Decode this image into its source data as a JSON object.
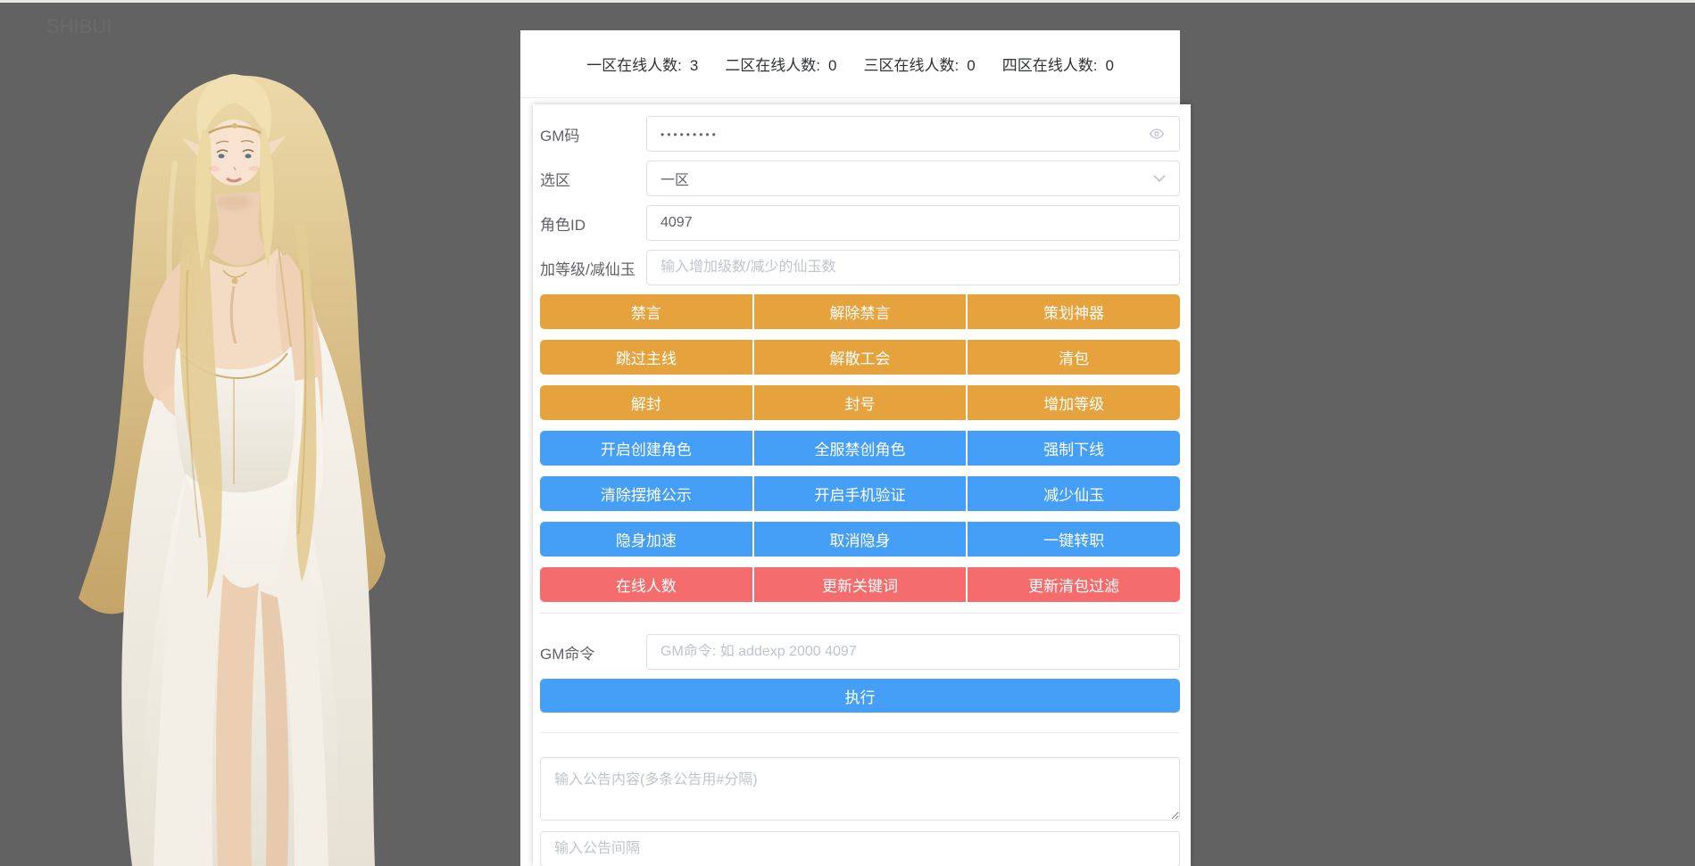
{
  "header": {
    "counts": [
      {
        "label": "一区在线人数:",
        "value": "3"
      },
      {
        "label": "二区在线人数:",
        "value": "0"
      },
      {
        "label": "三区在线人数:",
        "value": "0"
      },
      {
        "label": "四区在线人数:",
        "value": "0"
      }
    ]
  },
  "form": {
    "fields": [
      {
        "label": "GM码",
        "type": "password",
        "display_value": "•••••••••"
      },
      {
        "label": "选区",
        "type": "select",
        "value": "一区"
      },
      {
        "label": "角色ID",
        "type": "text",
        "value": "4097"
      },
      {
        "label": "加等级/减仙玉",
        "type": "text",
        "placeholder": "输入增加级数/减少的仙玉数"
      }
    ],
    "button_rows": [
      {
        "type": "warning",
        "buttons": [
          "禁言",
          "解除禁言",
          "策划神器"
        ]
      },
      {
        "type": "warning",
        "buttons": [
          "跳过主线",
          "解散工会",
          "清包"
        ]
      },
      {
        "type": "warning",
        "buttons": [
          "解封",
          "封号",
          "增加等级"
        ]
      },
      {
        "type": "primary",
        "buttons": [
          "开启创建角色",
          "全服禁创角色",
          "强制下线"
        ]
      },
      {
        "type": "primary",
        "buttons": [
          "清除摆摊公示",
          "开启手机验证",
          "减少仙玉"
        ]
      },
      {
        "type": "primary",
        "buttons": [
          "隐身加速",
          "取消隐身",
          "一键转职"
        ]
      },
      {
        "type": "danger",
        "buttons": [
          "在线人数",
          "更新关键词",
          "更新清包过滤"
        ]
      }
    ],
    "gm_command": {
      "label": "GM命令",
      "placeholder": "GM命令: 如 addexp 2000 4097",
      "execute_label": "执行"
    },
    "announcement": {
      "content_placeholder": "输入公告内容(多条公告用#分隔)",
      "interval_placeholder": "输入公告间隔"
    }
  },
  "icons": {
    "password_toggle": "eye-icon",
    "select_arrow": "chevron-down-icon"
  },
  "artwork": {
    "alt": "游戏角色立绘"
  },
  "colors": {
    "page_bg": "#626262",
    "panel_bg": "#ffffff",
    "warning": "#e6a23c",
    "primary": "#459ff6",
    "danger": "#f56c6c",
    "input_border": "#dcdfe6",
    "placeholder": "#c0c4cc",
    "label_text": "#606266",
    "divider": "#ebeef5"
  }
}
